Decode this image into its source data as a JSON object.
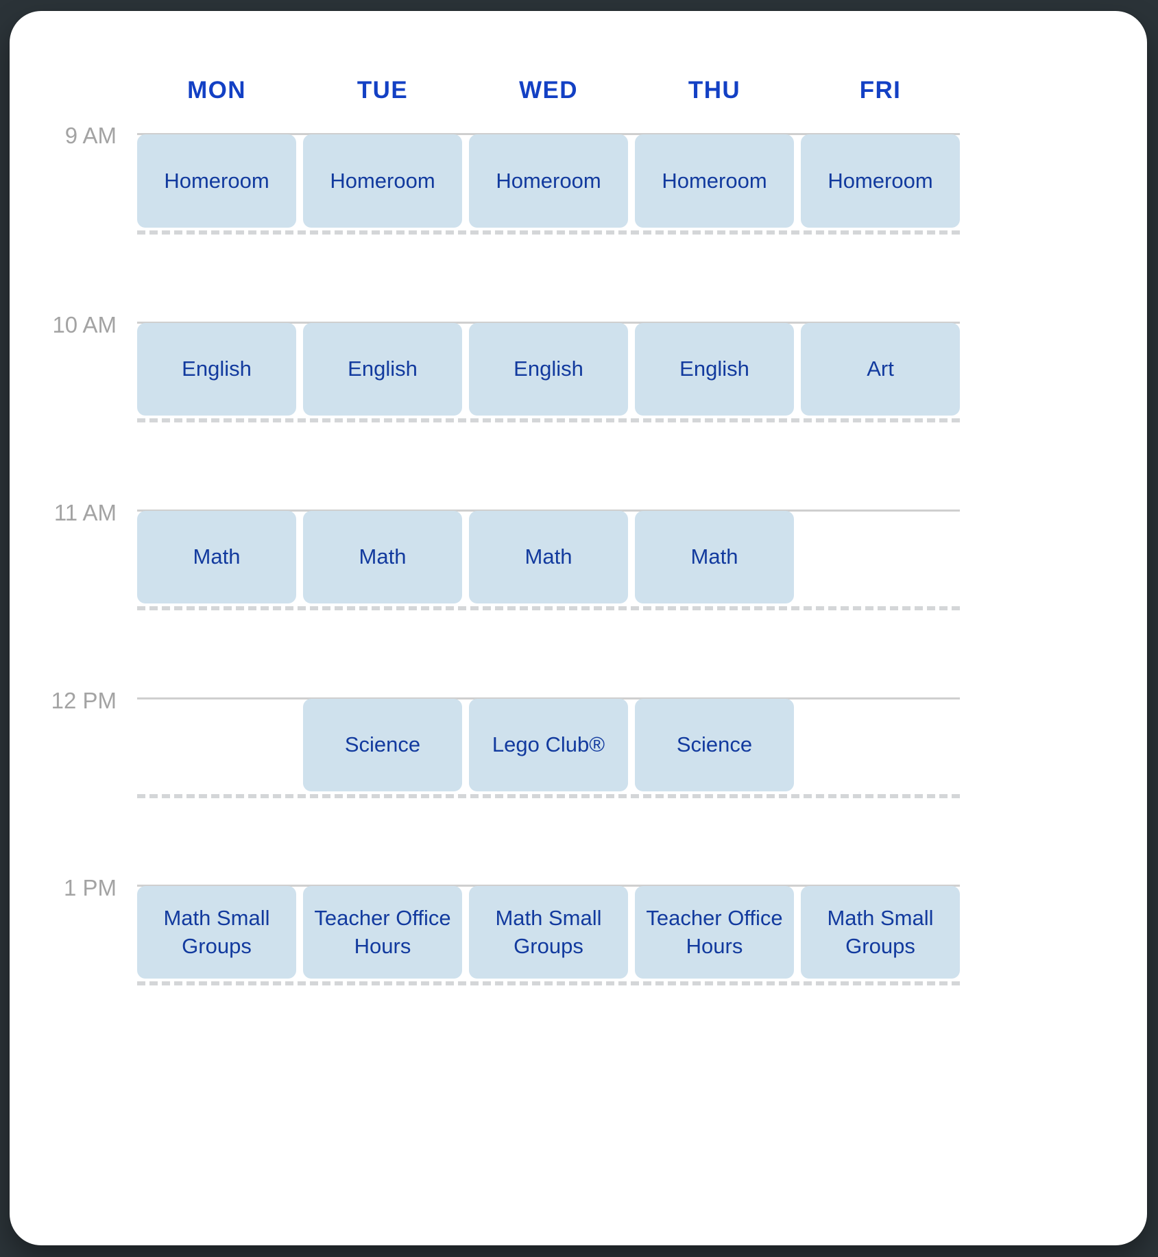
{
  "card": {
    "accent_color": "#1340c4",
    "event_bg_color": "#cfe1ed",
    "event_text_color": "#123a9e",
    "hour_line_color": "#cfcfcf",
    "dashed_line_color": "#d4d6d8",
    "time_label_color": "#a3a3a3",
    "background": "#ffffff",
    "page_background": "#2b3338"
  },
  "header": {
    "days": [
      {
        "label": "MON"
      },
      {
        "label": "TUE"
      },
      {
        "label": "WED"
      },
      {
        "label": "THU"
      },
      {
        "label": "FRI"
      }
    ]
  },
  "schedule": {
    "rows": [
      {
        "time_label": "9 AM",
        "events": [
          {
            "label": "Homeroom"
          },
          {
            "label": "Homeroom"
          },
          {
            "label": "Homeroom"
          },
          {
            "label": "Homeroom"
          },
          {
            "label": "Homeroom"
          }
        ]
      },
      {
        "time_label": "10 AM",
        "events": [
          {
            "label": "English"
          },
          {
            "label": "English"
          },
          {
            "label": "English"
          },
          {
            "label": "English"
          },
          {
            "label": "Art"
          }
        ]
      },
      {
        "time_label": "11 AM",
        "events": [
          {
            "label": "Math"
          },
          {
            "label": "Math"
          },
          {
            "label": "Math"
          },
          {
            "label": "Math"
          },
          {
            "label": ""
          }
        ]
      },
      {
        "time_label": "12 PM",
        "events": [
          {
            "label": ""
          },
          {
            "label": "Science"
          },
          {
            "label": "Lego Club®"
          },
          {
            "label": "Science"
          },
          {
            "label": ""
          }
        ]
      },
      {
        "time_label": "1 PM",
        "events": [
          {
            "label": "Math Small Groups"
          },
          {
            "label": "Teacher Office Hours"
          },
          {
            "label": "Math Small Groups"
          },
          {
            "label": "Teacher Office Hours"
          },
          {
            "label": "Math Small Groups"
          }
        ]
      }
    ]
  }
}
